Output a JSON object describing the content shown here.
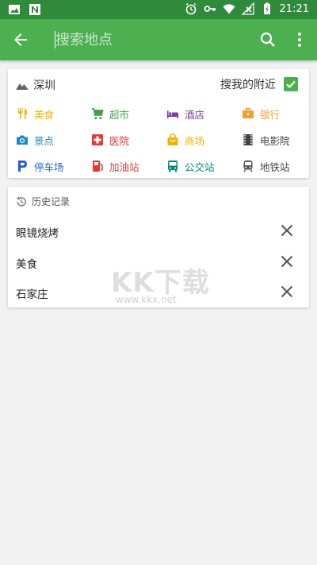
{
  "status_bar": {
    "time": "21:21",
    "left_icons": [
      "image-icon",
      "n-icon"
    ],
    "right_icons": [
      "alarm-icon",
      "key-icon",
      "wifi-icon",
      "signal-icon",
      "battery-icon"
    ]
  },
  "app_bar": {
    "search_placeholder": "搜索地点",
    "colors": {
      "bar": "#4caf50",
      "status": "#2f8a3c"
    }
  },
  "nearby": {
    "city": "深圳",
    "toggle_label": "搜我的附近",
    "toggle_checked": true,
    "categories": [
      {
        "label": "美食",
        "icon": "restaurant-icon",
        "color": "#f2b400"
      },
      {
        "label": "超市",
        "icon": "cart-icon",
        "color": "#43a047"
      },
      {
        "label": "酒店",
        "icon": "hotel-icon",
        "color": "#7b3fa0"
      },
      {
        "label": "银行",
        "icon": "bank-icon",
        "color": "#f0a030"
      },
      {
        "label": "景点",
        "icon": "camera-icon",
        "color": "#1e88c8"
      },
      {
        "label": "医院",
        "icon": "hospital-icon",
        "color": "#e53935"
      },
      {
        "label": "商场",
        "icon": "bag-icon",
        "color": "#f2b400"
      },
      {
        "label": "电影院",
        "icon": "film-icon",
        "color": "#444444"
      },
      {
        "label": "停车场",
        "icon": "parking-icon",
        "color": "#1e5fc8"
      },
      {
        "label": "加油站",
        "icon": "gas-icon",
        "color": "#e53935"
      },
      {
        "label": "公交站",
        "icon": "bus-icon",
        "color": "#00897b"
      },
      {
        "label": "地铁站",
        "icon": "subway-icon",
        "color": "#555555"
      }
    ]
  },
  "history": {
    "title": "历史记录",
    "items": [
      "眼镜烧烤",
      "美食",
      "石家庄"
    ]
  },
  "watermark": {
    "main": "KK下载",
    "sub": "www.kkx.net"
  }
}
